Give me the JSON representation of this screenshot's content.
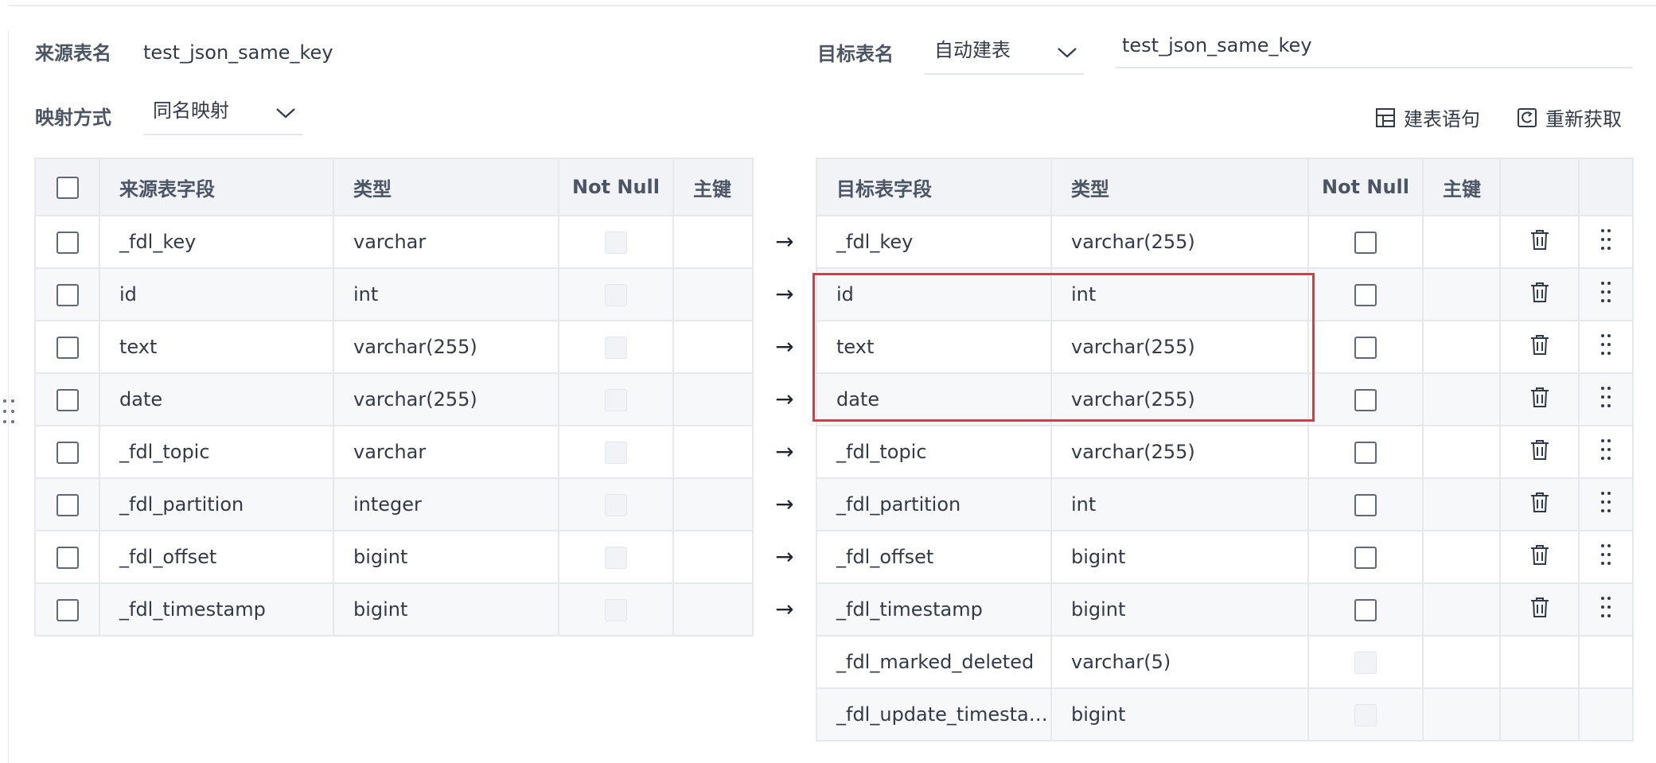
{
  "source": {
    "table_label": "来源表名",
    "table_name": "test_json_same_key",
    "mapping_label": "映射方式",
    "mapping_value": "同名映射"
  },
  "target": {
    "table_label": "目标表名",
    "mode_value": "自动建表",
    "table_name": "test_json_same_key"
  },
  "actions": {
    "ddl_label": "建表语句",
    "refresh_label": "重新获取"
  },
  "source_table": {
    "headers": {
      "field": "来源表字段",
      "type": "类型",
      "not_null": "Not Null",
      "pk": "主键"
    },
    "rows": [
      {
        "field": "_fdl_key",
        "type": "varchar"
      },
      {
        "field": "id",
        "type": "int"
      },
      {
        "field": "text",
        "type": "varchar(255)"
      },
      {
        "field": "date",
        "type": "varchar(255)"
      },
      {
        "field": "_fdl_topic",
        "type": "varchar"
      },
      {
        "field": "_fdl_partition",
        "type": "integer"
      },
      {
        "field": "_fdl_offset",
        "type": "bigint"
      },
      {
        "field": "_fdl_timestamp",
        "type": "bigint"
      }
    ]
  },
  "mapping_arrow": "→",
  "target_table": {
    "headers": {
      "field": "目标表字段",
      "type": "类型",
      "not_null": "Not Null",
      "pk": "主键"
    },
    "rows": [
      {
        "field": "_fdl_key",
        "type": "varchar(255)"
      },
      {
        "field": "id",
        "type": "int"
      },
      {
        "field": "text",
        "type": "varchar(255)"
      },
      {
        "field": "date",
        "type": "varchar(255)"
      },
      {
        "field": "_fdl_topic",
        "type": "varchar(255)"
      },
      {
        "field": "_fdl_partition",
        "type": "int"
      },
      {
        "field": "_fdl_offset",
        "type": "bigint"
      },
      {
        "field": "_fdl_timestamp",
        "type": "bigint"
      },
      {
        "field": "_fdl_marked_deleted",
        "type": "varchar(5)"
      },
      {
        "field": "_fdl_update_timesta…",
        "type": "bigint"
      }
    ]
  },
  "colors": {
    "highlight": "#e8343c",
    "header_bg": "#f1f3f6",
    "border": "#e6e8ec"
  }
}
